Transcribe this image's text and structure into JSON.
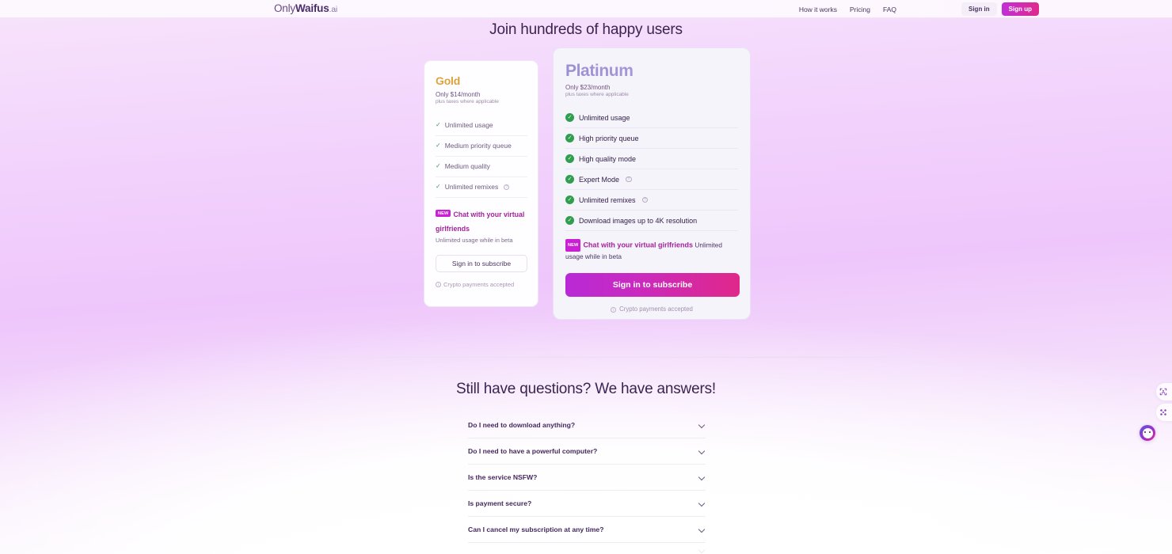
{
  "header": {
    "logo": {
      "part1": "Only",
      "part2": "Waifus",
      "part3": ".ai"
    },
    "nav": [
      {
        "label": "How it works"
      },
      {
        "label": "Pricing"
      },
      {
        "label": "FAQ"
      }
    ],
    "sign_in_label": "Sign in",
    "sign_up_label": "Sign up"
  },
  "pricing": {
    "title": "Join hundreds of happy users",
    "gold": {
      "name": "Gold",
      "price": "Only $14/month",
      "taxes": "plus taxes where applicable",
      "features": [
        {
          "label": "Unlimited usage",
          "info": false
        },
        {
          "label": "Medium priority queue",
          "info": false
        },
        {
          "label": "Medium quality",
          "info": false
        },
        {
          "label": "Unlimited remixes",
          "info": true
        }
      ],
      "promo_badge": "NEW",
      "promo_title": "Chat with your virtual girlfriends",
      "promo_sub": "Unlimited usage while in beta",
      "cta": "Sign in to subscribe",
      "crypto": "Crypto payments accepted",
      "accent_color": "#d79a2b"
    },
    "platinum": {
      "name": "Platinum",
      "price": "Only $23/month",
      "taxes": "plus taxes where applicable",
      "features": [
        {
          "label": "Unlimited usage",
          "info": false
        },
        {
          "label": "High priority queue",
          "info": false
        },
        {
          "label": "High quality mode",
          "info": false
        },
        {
          "label": "Expert Mode",
          "info": true
        },
        {
          "label": "Unlimited remixes",
          "info": true
        },
        {
          "label": "Download images up to 4K resolution",
          "info": false
        }
      ],
      "promo_badge": "NEW",
      "promo_title": "Chat with your virtual girlfriends",
      "promo_tail": "Unlimited usage while in beta",
      "cta": "Sign in to subscribe",
      "crypto": "Crypto payments accepted",
      "accent_color": "#9b8fd4",
      "cta_gradient_from": "#b829d6",
      "cta_gradient_to": "#e0288a"
    }
  },
  "faq": {
    "title": "Still have questions? We have answers!",
    "items": [
      {
        "question": "Do I need to download anything?"
      },
      {
        "question": "Do I need to have a powerful computer?"
      },
      {
        "question": "Is the service NSFW?"
      },
      {
        "question": "Is payment secure?"
      },
      {
        "question": "Can I cancel my subscription at any time?"
      }
    ]
  },
  "widgets": {
    "accessibility_icon": "accessibility-icon",
    "grid_icon": "grid-icon",
    "chat_icon": "chat-face-icon"
  },
  "theme": {
    "bg_top": "#f2d2fc",
    "bg_bottom": "#ffffff",
    "heading_color": "#3b2450",
    "new_badge_color": "#cb1fd6",
    "check_green": "#2f9e4f"
  }
}
